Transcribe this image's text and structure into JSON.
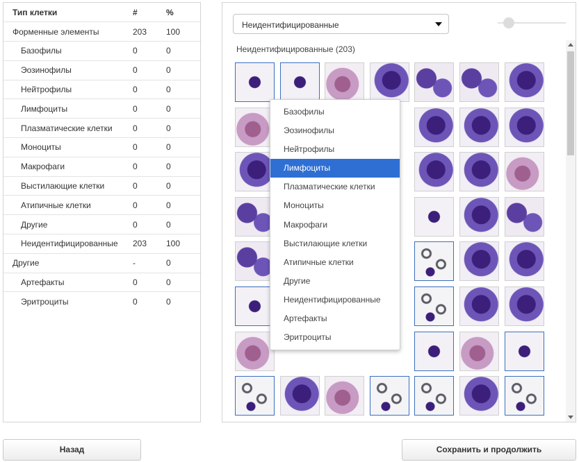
{
  "table": {
    "headers": {
      "type": "Тип клетки",
      "count": "#",
      "percent": "%"
    },
    "rows": [
      {
        "name": "Форменные элементы",
        "count": "203",
        "percent": "100",
        "level": 0
      },
      {
        "name": "Базофилы",
        "count": "0",
        "percent": "0",
        "level": 1
      },
      {
        "name": "Эозинофилы",
        "count": "0",
        "percent": "0",
        "level": 1
      },
      {
        "name": "Нейтрофилы",
        "count": "0",
        "percent": "0",
        "level": 1
      },
      {
        "name": "Лимфоциты",
        "count": "0",
        "percent": "0",
        "level": 1
      },
      {
        "name": "Плазматические клетки",
        "count": "0",
        "percent": "0",
        "level": 1
      },
      {
        "name": "Моноциты",
        "count": "0",
        "percent": "0",
        "level": 1
      },
      {
        "name": "Макрофаги",
        "count": "0",
        "percent": "0",
        "level": 1
      },
      {
        "name": "Выстилающие клетки",
        "count": "0",
        "percent": "0",
        "level": 1
      },
      {
        "name": "Атипичные клетки",
        "count": "0",
        "percent": "0",
        "level": 1
      },
      {
        "name": "Другие",
        "count": "0",
        "percent": "0",
        "level": 1
      },
      {
        "name": "Неидентифицированные",
        "count": "203",
        "percent": "100",
        "level": 1
      },
      {
        "name": "Другие",
        "count": "-",
        "percent": "0",
        "level": 0
      },
      {
        "name": "Артефакты",
        "count": "0",
        "percent": "0",
        "level": 1
      },
      {
        "name": "Эритроциты",
        "count": "0",
        "percent": "0",
        "level": 1
      }
    ]
  },
  "gallery": {
    "category_select": {
      "value": "Неидентифицированные",
      "icon": "caret-down-icon"
    },
    "zoom_slider": {
      "value": 0.05
    },
    "title": "Неидентифицированные (203)",
    "colors": {
      "stain_purple": "#5b3fa0",
      "nucleus_dark": "#3b1f7a",
      "cytoplasm": "#6d55b8",
      "granular": "#a0608f",
      "background": "#efeaf2",
      "selected_border": "#3a6fbd"
    },
    "thumbnails": [
      [
        "small-lymph",
        "small-lymph",
        "granular",
        "large-blue",
        "cluster",
        "cluster",
        "large-blue"
      ],
      [
        "granular",
        null,
        null,
        null,
        "large-blue",
        "large-blue",
        "large-blue"
      ],
      [
        "large-blue",
        null,
        null,
        null,
        "large-blue",
        "large-blue",
        "granular"
      ],
      [
        "cluster",
        null,
        null,
        null,
        "small-lymph",
        "large-blue",
        "cluster"
      ],
      [
        "cluster",
        null,
        null,
        null,
        "rbc",
        "large-blue",
        "large-blue"
      ],
      [
        "small-lymph",
        null,
        null,
        null,
        "rbc",
        "large-blue",
        "large-blue"
      ],
      [
        "granular",
        null,
        null,
        null,
        "small-lymph",
        "granular",
        "small-lymph"
      ],
      [
        "rbc",
        "large-blue",
        "granular",
        "rbc",
        "rbc",
        "large-blue",
        "rbc"
      ]
    ],
    "selected": [
      [
        0,
        0
      ],
      [
        0,
        1
      ],
      [
        4,
        4
      ],
      [
        5,
        0
      ],
      [
        5,
        4
      ],
      [
        6,
        4
      ],
      [
        6,
        6
      ],
      [
        7,
        0
      ],
      [
        7,
        3
      ],
      [
        7,
        4
      ],
      [
        7,
        6
      ]
    ]
  },
  "context_menu": {
    "items": [
      "Базофилы",
      "Эозинофилы",
      "Нейтрофилы",
      "Лимфоциты",
      "Плазматические клетки",
      "Моноциты",
      "Макрофаги",
      "Выстилающие клетки",
      "Атипичные клетки",
      "Другие",
      "Неидентифицированные",
      "Артефакты",
      "Эритроциты"
    ],
    "highlighted": "Лимфоциты"
  },
  "buttons": {
    "back_label": "Назад",
    "save_continue_label": "Сохранить и продолжить"
  }
}
